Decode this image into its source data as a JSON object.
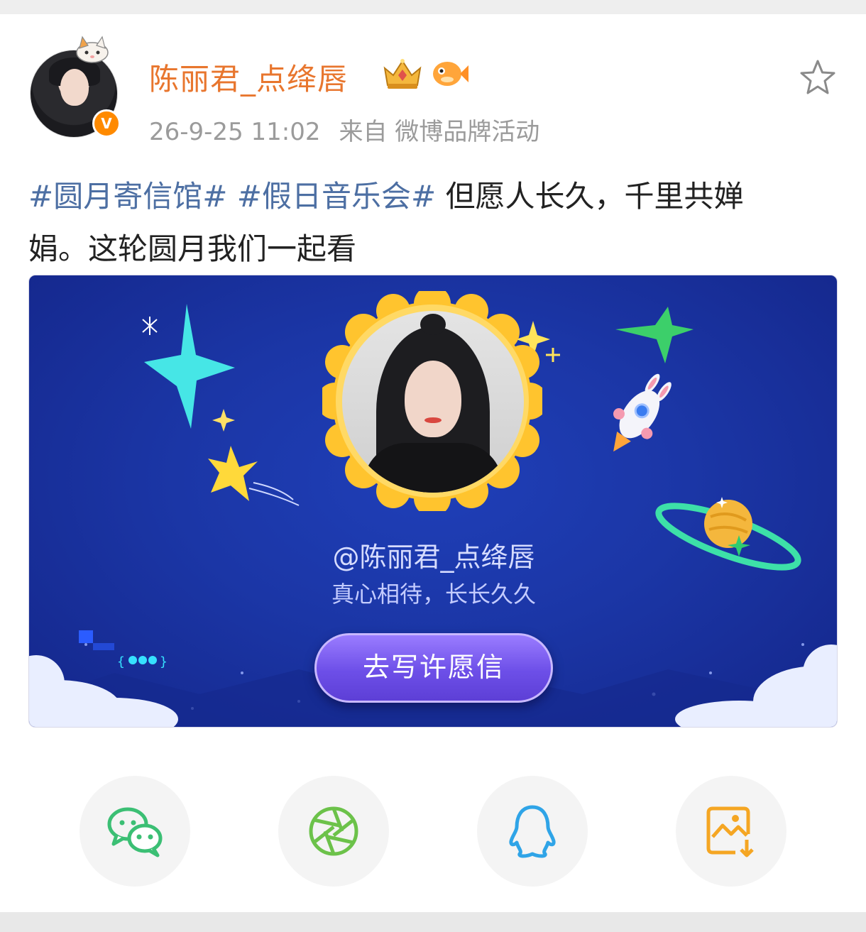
{
  "post": {
    "author": "陈丽君_点绛唇",
    "verified_badge": "V",
    "timestamp": "26-9-25 11:02",
    "source": "来自 微博品牌活动",
    "hashtags": [
      "#圆月寄信馆#",
      "#假日音乐会#"
    ],
    "text_line1_rest": " 但愿人长久，千里共婵",
    "text_line2": "娟。这轮圆月我们一起看"
  },
  "banner": {
    "handle": "@陈丽君_点绛唇",
    "slogan": "真心相待，长长久久",
    "cta_label": "去写许愿信"
  },
  "share": [
    {
      "name": "wechat",
      "icon": "wechat-icon",
      "color": "#3bbf74"
    },
    {
      "name": "moments",
      "icon": "moments-aperture-icon",
      "color": "#6cc24a"
    },
    {
      "name": "qq",
      "icon": "qq-penguin-icon",
      "color": "#2fa4e7"
    },
    {
      "name": "save-image",
      "icon": "save-image-icon",
      "color": "#f5a623"
    }
  ],
  "colors": {
    "username": "#e8762e",
    "hashtag": "#4d6fa3",
    "meta": "#9b9b9b",
    "banner_bg": "#1b36a6",
    "cta": "#6d4fe8"
  }
}
